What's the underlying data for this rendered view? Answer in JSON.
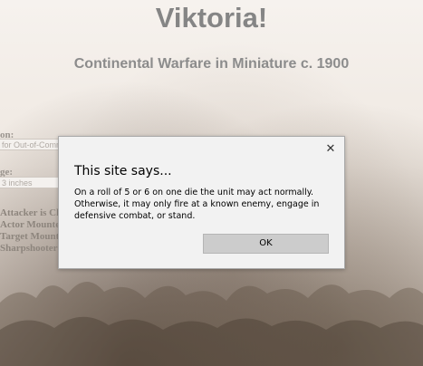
{
  "header": {
    "title": "Viktoria!",
    "subtitle": "Continental Warfare in Miniature c. 1900"
  },
  "form": {
    "fragments": [
      {
        "label": "on:",
        "field": "for Out-of-Comm"
      },
      {
        "label": "ge:",
        "field": "3 inches"
      }
    ],
    "option_rows": [
      "Attacker is Ch",
      "Actor Mounte",
      "Target Mounte",
      "Sharpshooter"
    ]
  },
  "dialog": {
    "title": "This site says...",
    "message": "On a roll of 5 or 6 on one die the unit may act normally. Otherwise, it may only fire at a known enemy, engage in defensive combat, or stand.",
    "ok_label": "OK",
    "close_icon": "close-icon"
  },
  "colors": {
    "dialog_bg": "#f2f2f2",
    "ok_button_bg": "#cccccc",
    "heading_gray": "#858585"
  }
}
